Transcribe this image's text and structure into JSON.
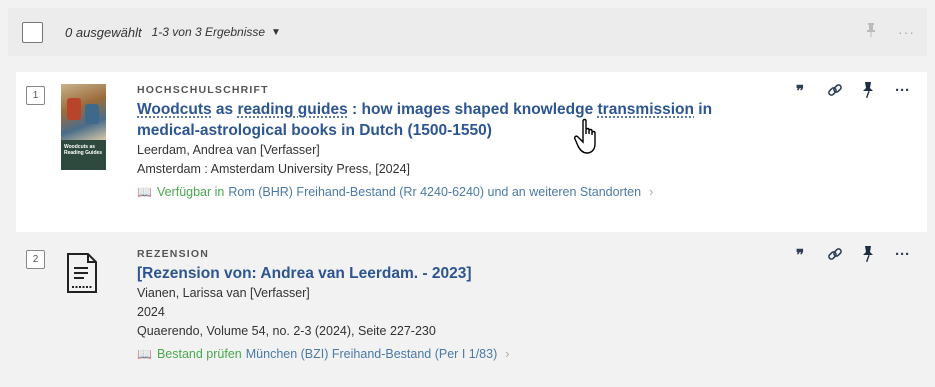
{
  "toolbar": {
    "selected_label": "0 ausgewählt",
    "results_label": "1-3 von 3 Ergebnisse"
  },
  "results": [
    {
      "number": "1",
      "type": "HOCHSCHULSCHRIFT",
      "title_part1": "Woodcuts",
      "title_part2": " as ",
      "title_part3": "reading guides",
      "title_part4": " : how images shaped knowledge ",
      "title_part5": "transmission",
      "title_part6": " in",
      "title_line2": "medical-astrological books in Dutch (1500-1550)",
      "author": "Leerdam, Andrea van [Verfasser]",
      "publisher": "Amsterdam : Amsterdam University Press, [2024]",
      "avail_status": "Verfügbar in",
      "avail_location": "Rom (BHR)  Freihand-Bestand (Rr 4240-6240) und an weiteren Standorten",
      "thumb_title": "Woodcuts as Reading Guides"
    },
    {
      "number": "2",
      "type": "REZENSION",
      "title": "[Rezension von: Andrea van Leerdam. - 2023]",
      "author": "Vianen, Larissa van [Verfasser]",
      "year": "2024",
      "source": "Quaerendo, Volume 54, no. 2-3 (2024), Seite 227-230",
      "avail_status": "Bestand prüfen",
      "avail_location": "München (BZI)  Freihand-Bestand (Per I 1/83)"
    }
  ],
  "icons": {
    "cite": "quote-icon",
    "link": "link-icon",
    "pin": "pin-icon",
    "more": "more-icon",
    "book": "book-icon"
  },
  "colors": {
    "link": "#2d5591",
    "available": "#4aa84f",
    "location": "#4a7aa8"
  }
}
